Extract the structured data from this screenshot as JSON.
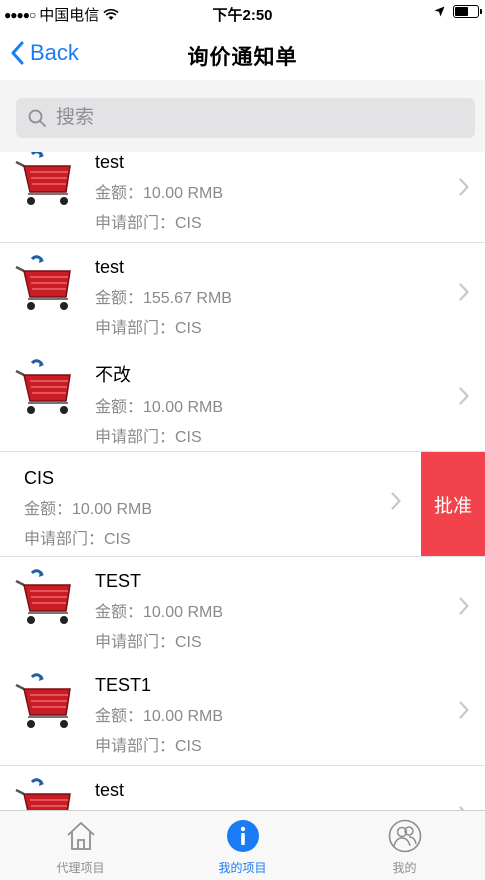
{
  "status_bar": {
    "carrier": "中国电信",
    "time": "下午2:50"
  },
  "nav": {
    "back_label": "Back",
    "title": "询价通知单"
  },
  "search": {
    "placeholder": "搜索"
  },
  "list": {
    "items": [
      {
        "title": "test",
        "amount": "金额：10.00 RMB",
        "dept": "申请部门：CIS"
      },
      {
        "title": "test",
        "amount": "金额：155.67 RMB",
        "dept": "申请部门：CIS"
      },
      {
        "title": "不改",
        "amount": "金额：10.00 RMB",
        "dept": "申请部门：CIS"
      },
      {
        "title": "CIS",
        "amount": "金额：10.00 RMB",
        "dept": "申请部门：CIS",
        "action": "批准"
      },
      {
        "title": "TEST",
        "amount": "金额：10.00 RMB",
        "dept": "申请部门：CIS"
      },
      {
        "title": "TEST1",
        "amount": "金额：10.00 RMB",
        "dept": "申请部门：CIS"
      },
      {
        "title": "test",
        "amount": "",
        "dept": ""
      }
    ]
  },
  "tabs": [
    {
      "label": "代理项目",
      "icon": "home-icon"
    },
    {
      "label": "我的项目",
      "icon": "info-icon",
      "active": true
    },
    {
      "label": "我的",
      "icon": "user-icon"
    }
  ],
  "colors": {
    "accent": "#1a7cf5",
    "action_red": "#f2424b"
  }
}
